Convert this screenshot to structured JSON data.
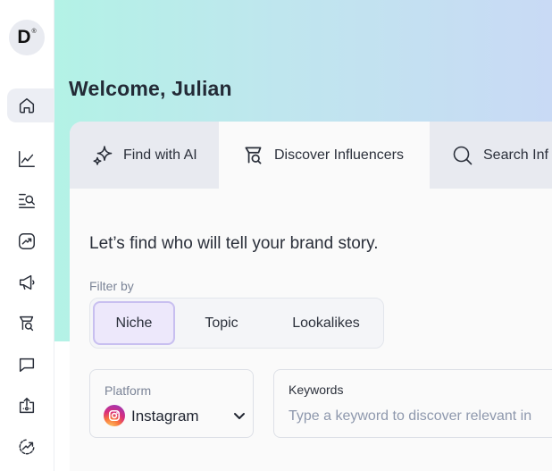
{
  "logo": {
    "letter": "D",
    "mark": "®"
  },
  "sidebar": {
    "items": [
      {
        "icon": "home-icon",
        "active": true
      },
      {
        "icon": "line-chart-icon",
        "active": false
      },
      {
        "icon": "search-list-icon",
        "active": false
      },
      {
        "icon": "trend-box-icon",
        "active": false
      },
      {
        "icon": "megaphone-icon",
        "active": false
      },
      {
        "icon": "influencer-search-icon",
        "active": false
      },
      {
        "icon": "chat-icon",
        "active": false
      },
      {
        "icon": "upload-box-icon",
        "active": false
      },
      {
        "icon": "growth-circle-icon",
        "active": false
      }
    ]
  },
  "header": {
    "welcome": "Welcome, Julian"
  },
  "tabs": [
    {
      "label": "Find with AI",
      "icon": "sparkles-icon"
    },
    {
      "label": "Discover Influencers",
      "icon": "influencer-search-icon",
      "active": true
    },
    {
      "label": "Search Inf",
      "icon": "search-icon"
    }
  ],
  "main": {
    "prompt": "Let’s find who will tell your brand story.",
    "filter_label": "Filter by",
    "filters": [
      "Niche",
      "Topic",
      "Lookalikes"
    ],
    "selected_filter": "Niche"
  },
  "platform": {
    "label": "Platform",
    "value": "Instagram",
    "icon": "instagram-icon"
  },
  "keywords": {
    "label": "Keywords",
    "placeholder": "Type a keyword to discover relevant in"
  },
  "colors": {
    "accent": "#ede8fb",
    "accent_border": "#c8bff0",
    "gradient_start": "#b3f2e6",
    "gradient_end": "#c9daf5"
  }
}
